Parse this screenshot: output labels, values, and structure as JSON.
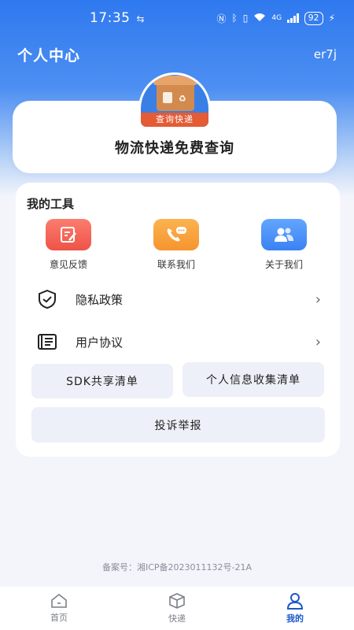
{
  "status_bar": {
    "time": "17:35",
    "battery": "92",
    "network": "4G"
  },
  "header": {
    "title": "个人中心",
    "user": "er7j"
  },
  "top_card": {
    "logo_banner": "查询快递",
    "title": "物流快递免费查询"
  },
  "tools": {
    "section_title": "我的工具",
    "items": [
      {
        "label": "意见反馈",
        "icon": "edit-note-icon"
      },
      {
        "label": "联系我们",
        "icon": "phone-chat-icon"
      },
      {
        "label": "关于我们",
        "icon": "users-icon"
      }
    ]
  },
  "menu": {
    "privacy": "隐私政策",
    "agreement": "用户协议"
  },
  "buttons": {
    "sdk_list": "SDK共享清单",
    "personal_info_list": "个人信息收集清单",
    "complaint": "投诉举报"
  },
  "footer": {
    "icp": "备案号：湘ICP备2023011132号-21A"
  },
  "tabbar": {
    "items": [
      {
        "label": "首页",
        "icon": "home-icon"
      },
      {
        "label": "快递",
        "icon": "package-icon"
      },
      {
        "label": "我的",
        "icon": "user-icon"
      }
    ],
    "active_index": 2
  },
  "colors": {
    "primary": "#2f79ef",
    "active_tab": "#1a57c9",
    "button_bg": "#edf0f8"
  }
}
